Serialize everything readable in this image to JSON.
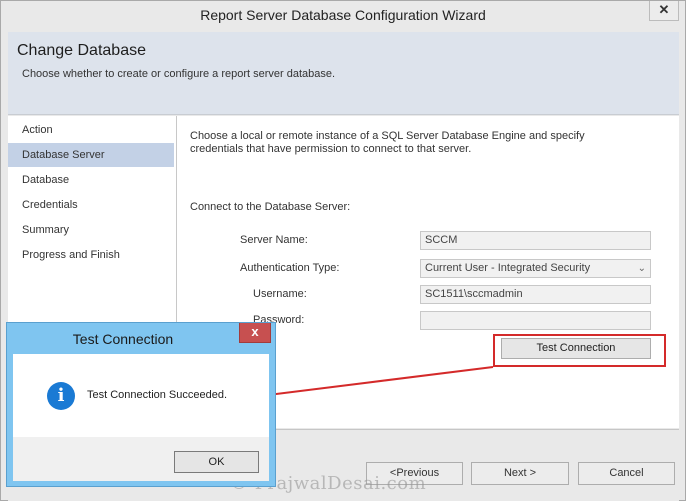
{
  "window": {
    "title": "Report Server Database Configuration Wizard",
    "close_glyph": "✕"
  },
  "header": {
    "title": "Change Database",
    "subtitle": "Choose whether to create or configure a report server database."
  },
  "nav": {
    "items": [
      {
        "label": "Action"
      },
      {
        "label": "Database Server",
        "selected": true
      },
      {
        "label": "Database"
      },
      {
        "label": "Credentials"
      },
      {
        "label": "Summary"
      },
      {
        "label": "Progress and Finish"
      }
    ]
  },
  "content": {
    "description": "Choose a local or remote instance of a SQL Server Database Engine and specify credentials that have permission to connect to that server.",
    "section_label": "Connect to the Database Server:",
    "server_name": {
      "label": "Server Name:",
      "value": "SCCM"
    },
    "auth_type": {
      "label": "Authentication Type:",
      "value": "Current User - Integrated Security"
    },
    "username": {
      "label": "Username:",
      "value": "SC1511\\sccmadmin"
    },
    "password": {
      "label": "Password:",
      "value": ""
    },
    "test_button": "Test Connection"
  },
  "footer": {
    "previous": "Previous",
    "next": "Next",
    "cancel": "Cancel"
  },
  "dialog": {
    "title": "Test Connection",
    "close_glyph": "x",
    "icon_glyph": "i",
    "message": "Test Connection Succeeded.",
    "ok": "OK"
  },
  "watermark": "© PrajwalDesai.com",
  "colors": {
    "annotation": "#d42a2a",
    "dialog_frame": "#7fc5f0",
    "nav_selected": "#c3d1e6"
  }
}
